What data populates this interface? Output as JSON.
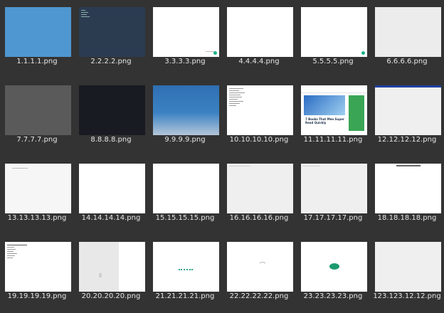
{
  "files": [
    {
      "name": "1.1.1.1.png"
    },
    {
      "name": "2.2.2.2.png"
    },
    {
      "name": "3.3.3.3.png"
    },
    {
      "name": "4.4.4.4.png"
    },
    {
      "name": "5.5.5.5.png"
    },
    {
      "name": "6.6.6.6.png"
    },
    {
      "name": "7.7.7.7.png"
    },
    {
      "name": "8.8.8.8.png"
    },
    {
      "name": "9.9.9.9.png"
    },
    {
      "name": "10.10.10.10.png"
    },
    {
      "name": "11.11.11.11.png"
    },
    {
      "name": "12.12.12.12.png"
    },
    {
      "name": "13.13.13.13.png"
    },
    {
      "name": "14.14.14.14.png"
    },
    {
      "name": "15.15.15.15.png"
    },
    {
      "name": "16.16.16.16.png"
    },
    {
      "name": "17.17.17.17.png"
    },
    {
      "name": "18.18.18.18.png"
    },
    {
      "name": "19.19.19.19.png"
    },
    {
      "name": "20.20.20.20.png"
    },
    {
      "name": "21.21.21.21.png"
    },
    {
      "name": "22.22.22.22.png"
    },
    {
      "name": "23.23.23.23.png"
    },
    {
      "name": "123.123.12.12.png"
    }
  ],
  "thumbnail_site": {
    "headline": "7 Books That Men Super Read Quickly"
  },
  "colors": {
    "background": "#333333",
    "label_text": "#e6e6e6"
  }
}
